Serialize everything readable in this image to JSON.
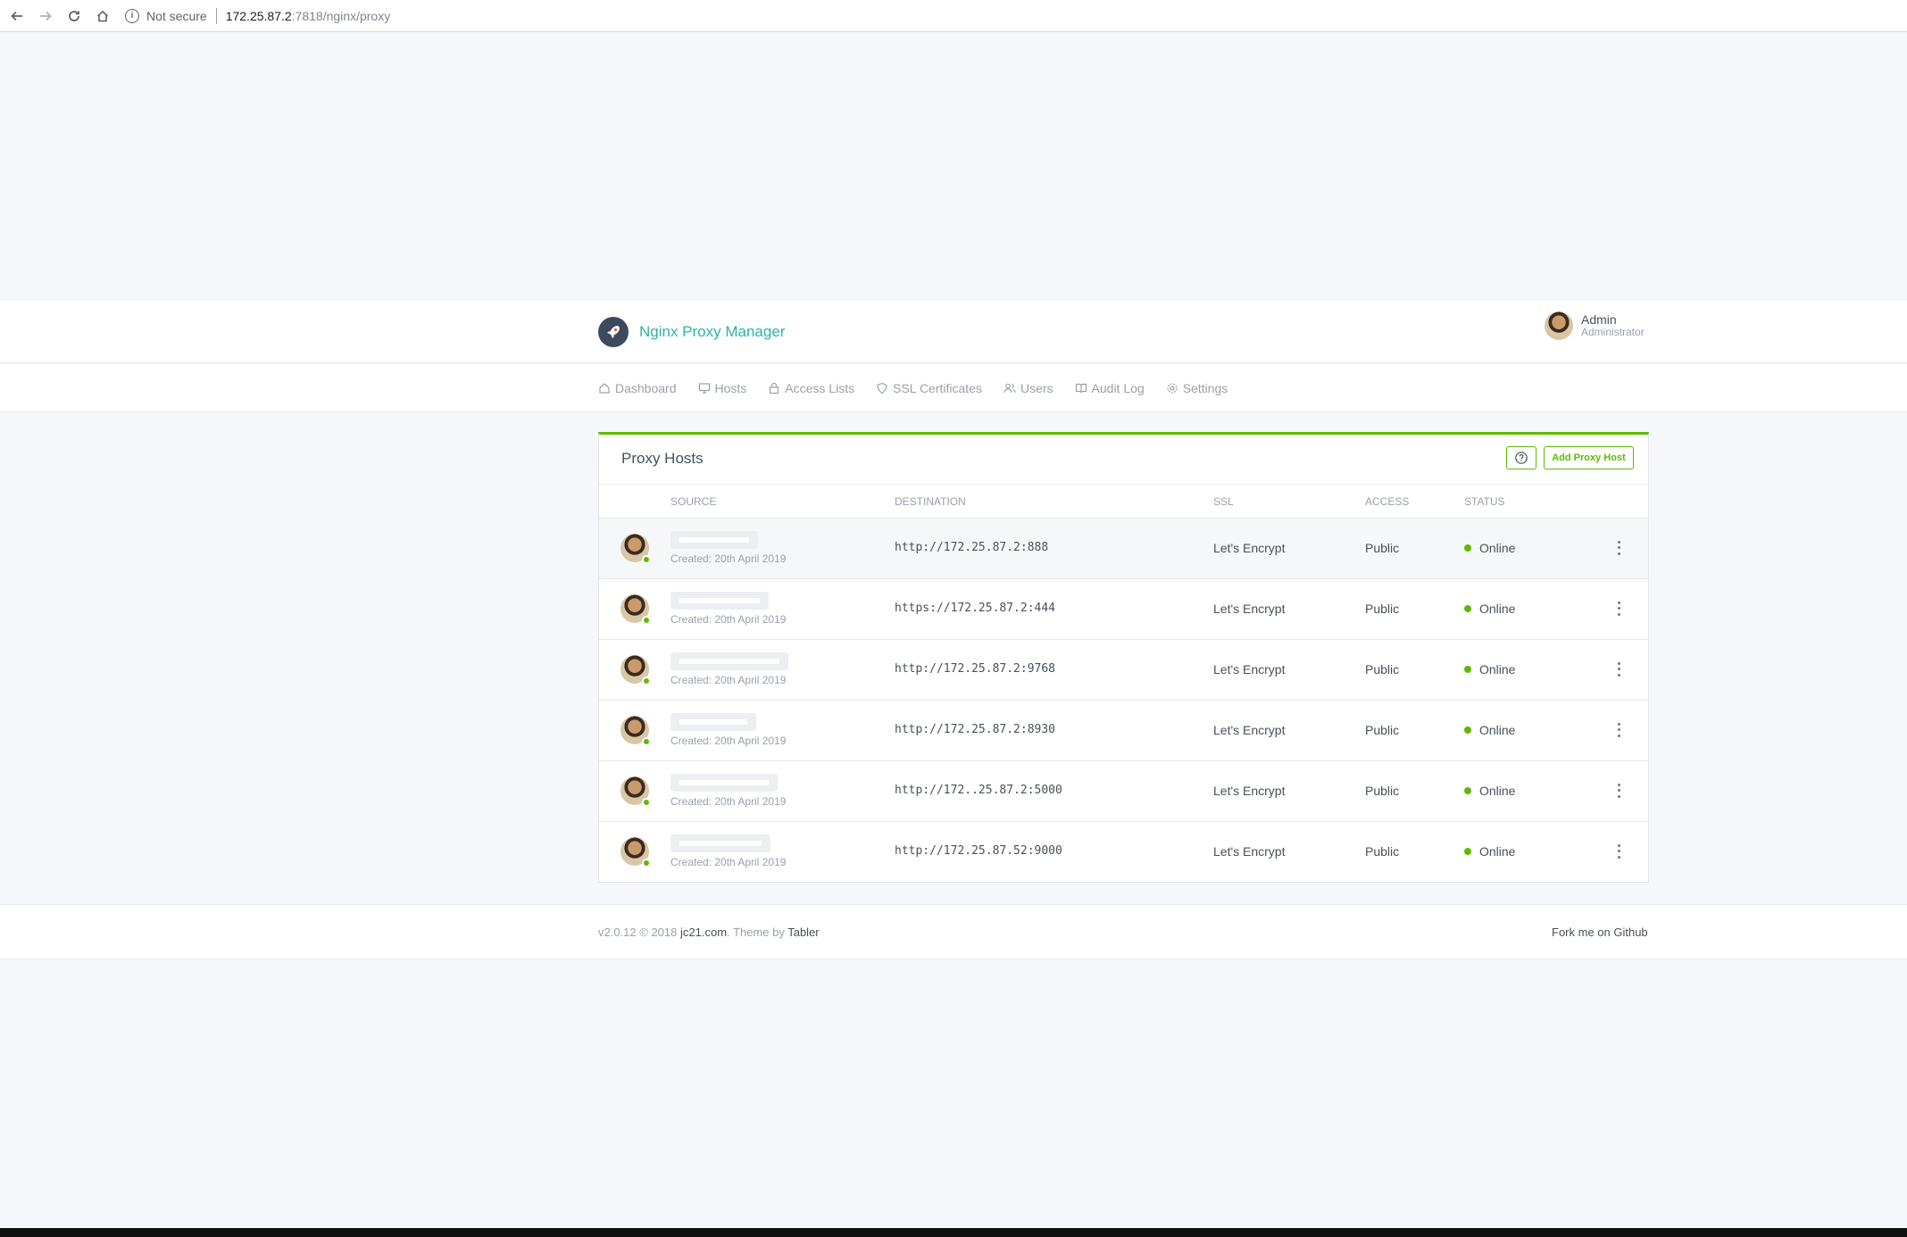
{
  "browser": {
    "not_secure": "Not secure",
    "url_host": "172.25.87.2",
    "url_path": ":7818/nginx/proxy"
  },
  "header": {
    "app_title": "Nginx Proxy Manager",
    "user_name": "Admin",
    "user_role": "Administrator"
  },
  "nav": {
    "items": [
      {
        "label": "Dashboard",
        "icon": "home-icon"
      },
      {
        "label": "Hosts",
        "icon": "monitor-icon"
      },
      {
        "label": "Access Lists",
        "icon": "lock-icon"
      },
      {
        "label": "SSL Certificates",
        "icon": "shield-icon"
      },
      {
        "label": "Users",
        "icon": "users-icon"
      },
      {
        "label": "Audit Log",
        "icon": "book-icon"
      },
      {
        "label": "Settings",
        "icon": "gear-icon"
      }
    ]
  },
  "card": {
    "title": "Proxy Hosts",
    "add_button": "Add Proxy Host",
    "columns": {
      "source": "SOURCE",
      "destination": "DESTINATION",
      "ssl": "SSL",
      "access": "ACCESS",
      "status": "STATUS"
    },
    "rows": [
      {
        "created": "Created: 20th April 2019",
        "destination": "http://172.25.87.2:888",
        "ssl": "Let's Encrypt",
        "access": "Public",
        "status": "Online"
      },
      {
        "created": "Created: 20th April 2019",
        "destination": "https://172.25.87.2:444",
        "ssl": "Let's Encrypt",
        "access": "Public",
        "status": "Online"
      },
      {
        "created": "Created: 20th April 2019",
        "destination": "http://172.25.87.2:9768",
        "ssl": "Let's Encrypt",
        "access": "Public",
        "status": "Online"
      },
      {
        "created": "Created: 20th April 2019",
        "destination": "http://172.25.87.2:8930",
        "ssl": "Let's Encrypt",
        "access": "Public",
        "status": "Online"
      },
      {
        "created": "Created: 20th April 2019",
        "destination": "http://172..25.87.2:5000",
        "ssl": "Let's Encrypt",
        "access": "Public",
        "status": "Online"
      },
      {
        "created": "Created: 20th April 2019",
        "destination": "http://172.25.87.52:9000",
        "ssl": "Let's Encrypt",
        "access": "Public",
        "status": "Online"
      }
    ]
  },
  "footer": {
    "version": "v2.0.12 © 2018",
    "site": "jc21.com",
    "theme_by": ". Theme by",
    "theme": "Tabler",
    "fork": "Fork me on Github"
  },
  "colors": {
    "accent": "#5eba00",
    "brand_text": "#2bb3a5"
  }
}
